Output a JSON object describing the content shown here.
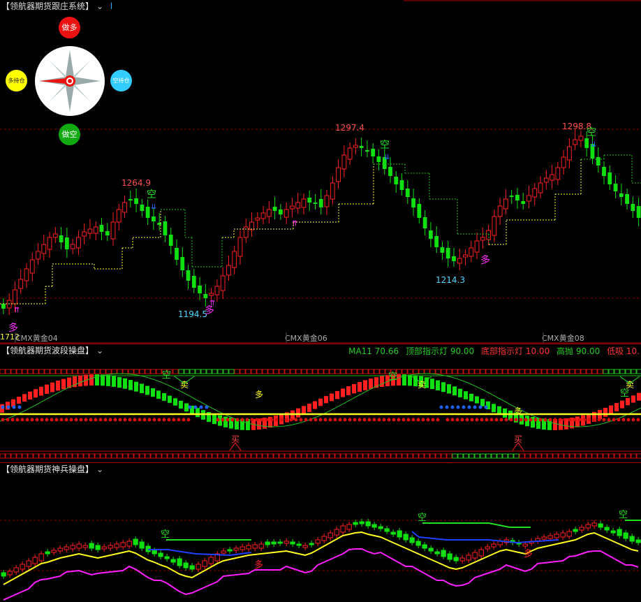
{
  "panels": {
    "main": {
      "title": "【领航器期货跟庄系统】",
      "flag": "l"
    },
    "wave": {
      "title": "【领航器期货波段操盘】"
    },
    "soldier": {
      "title": "【领航器期货神兵操盘】"
    }
  },
  "compass": {
    "top": "做多",
    "left": "多持仓",
    "right": "空持仓",
    "bottom": "做空"
  },
  "main_chart": {
    "high_labels": [
      "1264.9",
      "1297.4",
      "1298.8"
    ],
    "low_labels": [
      "1194.5",
      "1214.3"
    ],
    "left_price": "1712",
    "contracts": [
      "CMX黄金04",
      "CMX黄金06",
      "CMX黄金08"
    ],
    "signals": {
      "short": "空",
      "long": "多"
    }
  },
  "indicators": [
    {
      "name": "MA11",
      "value": "70.66",
      "color": "#22cc22"
    },
    {
      "name": "顶部指示灯",
      "value": "90.00",
      "color": "#22cc22"
    },
    {
      "name": "底部指示灯",
      "value": "10.00",
      "color": "#ff3333"
    },
    {
      "name": "高抛",
      "value": "90.00",
      "color": "#22cc22"
    },
    {
      "name": "低吸",
      "value": "10.",
      "color": "#ff3333"
    }
  ],
  "wave_chart": {
    "tags": {
      "short": "空",
      "sell": "卖",
      "long": "多",
      "buy": "买"
    }
  },
  "soldier_chart": {
    "tags": {
      "short": "空",
      "long": "多"
    }
  },
  "colors": {
    "up": "#ff2020",
    "down": "#10e010",
    "dash_up": "#ffff40",
    "dash_down": "#20c020",
    "grid": "#8b0000"
  }
}
